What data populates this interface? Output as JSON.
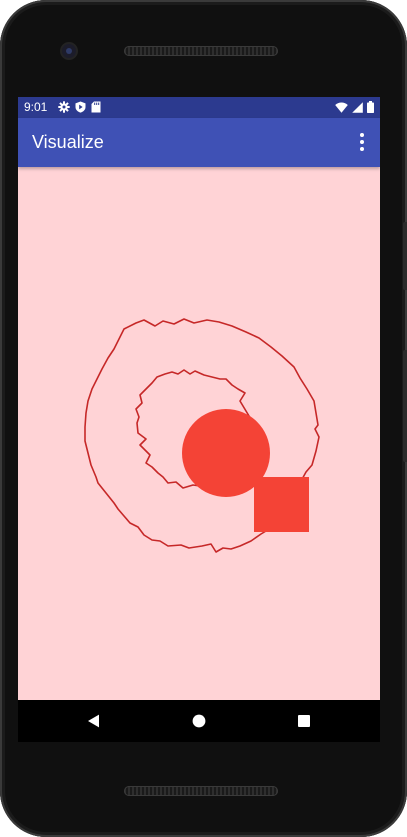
{
  "status_bar": {
    "time": "9:01",
    "left_icons": [
      "gear-icon",
      "play-protect-icon",
      "sd-card-icon"
    ],
    "right_icons": [
      "wifi-icon",
      "cell-signal-icon",
      "battery-icon"
    ]
  },
  "app_bar": {
    "title": "Visualize",
    "menu_icon": "overflow-menu-icon"
  },
  "canvas": {
    "background": "#ffd3d6",
    "outline_color": "#c62828",
    "shape_color": "#f44336",
    "shapes": [
      "outer-noisy-ring",
      "inner-noisy-ring",
      "filled-circle",
      "filled-square"
    ]
  },
  "nav_bar": {
    "buttons": [
      "back-icon",
      "home-icon",
      "recents-icon"
    ]
  },
  "colors": {
    "status_bar": "#2c3a8f",
    "app_bar": "#3f51b5",
    "screen_background": "#ffd3d6"
  }
}
